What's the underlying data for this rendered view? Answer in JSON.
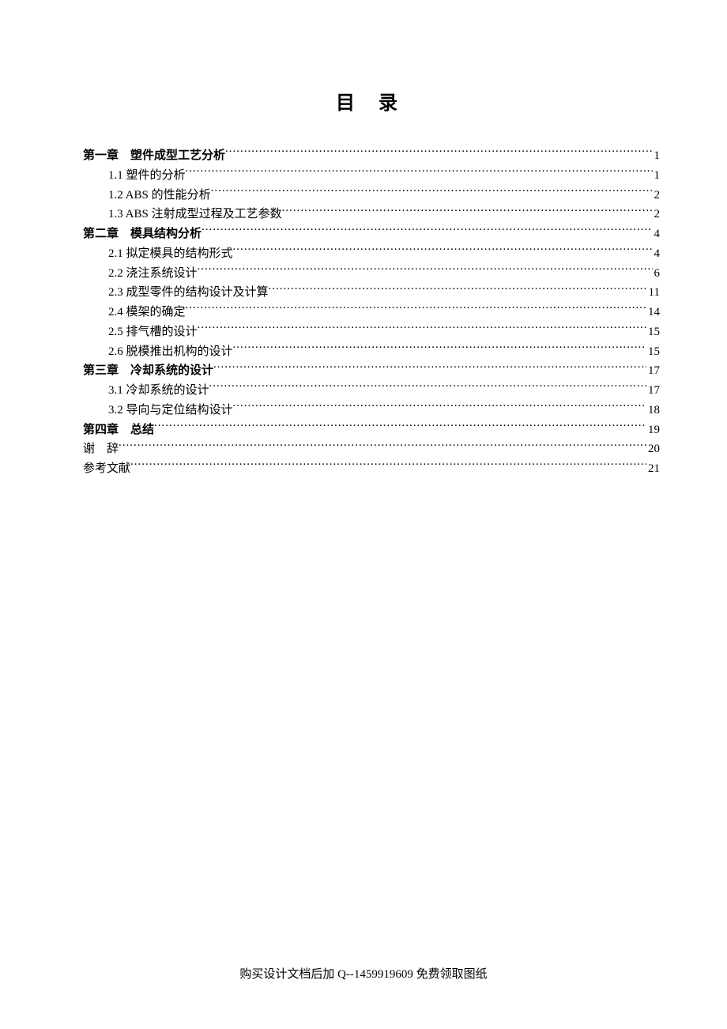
{
  "title": "目 录",
  "toc": [
    {
      "type": "chapter",
      "label": "第一章　塑件成型工艺分析",
      "page": "1"
    },
    {
      "type": "sub",
      "label": "1.1 塑件的分析",
      "page": "1"
    },
    {
      "type": "sub",
      "label": "1.2 ABS 的性能分析",
      "page": "2"
    },
    {
      "type": "sub",
      "label": "1.3 ABS 注射成型过程及工艺参数",
      "page": "2"
    },
    {
      "type": "chapter",
      "label": "第二章　模具结构分析",
      "page": "4"
    },
    {
      "type": "sub",
      "label": "2.1 拟定模具的结构形式",
      "page": "4"
    },
    {
      "type": "sub",
      "label": "2.2 浇注系统设计",
      "page": "6"
    },
    {
      "type": "sub",
      "label": "2.3 成型零件的结构设计及计算",
      "page": "11"
    },
    {
      "type": "sub",
      "label": "2.4 模架的确定",
      "page": "14"
    },
    {
      "type": "sub",
      "label": "2.5 排气槽的设计",
      "page": "15"
    },
    {
      "type": "sub",
      "label": "2.6 脱模推出机构的设计",
      "page": "15"
    },
    {
      "type": "chapter",
      "label": "第三章　冷却系统的设计",
      "page": "17"
    },
    {
      "type": "sub",
      "label": "3.1 冷却系统的设计",
      "page": "17"
    },
    {
      "type": "sub",
      "label": "3.2 导向与定位结构设计",
      "page": "18"
    },
    {
      "type": "chapter",
      "label": "第四章　总结",
      "page": "19"
    },
    {
      "type": "plain",
      "label": "谢　辞",
      "page": "20"
    },
    {
      "type": "plain",
      "label": "参考文献",
      "page": "21"
    }
  ],
  "footer": "购买设计文档后加 Q--1459919609 免费领取图纸"
}
